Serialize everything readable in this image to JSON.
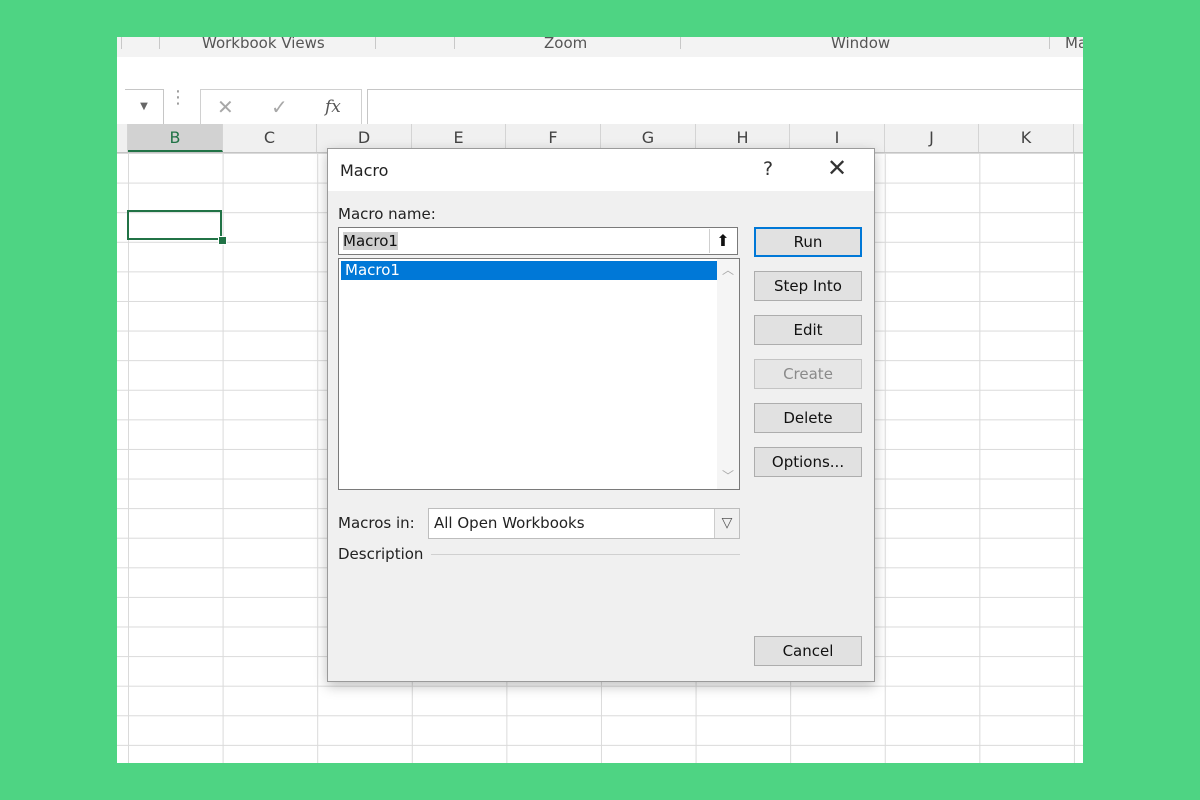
{
  "ribbon": {
    "groups": [
      "Workbook Views",
      "Zoom",
      "Window",
      "Ma"
    ]
  },
  "formula_bar": {
    "cancel_icon": "✕",
    "enter_icon": "✓",
    "fx_label": "fx",
    "value": ""
  },
  "grid": {
    "columns": [
      "B",
      "C",
      "D",
      "E",
      "F",
      "G",
      "H",
      "I",
      "J",
      "K"
    ],
    "selected_column": "B"
  },
  "dialog": {
    "title": "Macro",
    "help_label": "?",
    "close_label": "✕",
    "macro_name_label": "Macro name:",
    "macro_name_value": "Macro1",
    "list_items": [
      "Macro1"
    ],
    "buttons": {
      "run": "Run",
      "step_into": "Step Into",
      "edit": "Edit",
      "create": "Create",
      "delete": "Delete",
      "options": "Options...",
      "cancel": "Cancel"
    },
    "macros_in_label": "Macros in:",
    "macros_in_value": "All Open Workbooks",
    "description_label": "Description"
  },
  "colors": {
    "accent": "#0078d7",
    "excel_green": "#217346",
    "background": "#4ed483"
  }
}
